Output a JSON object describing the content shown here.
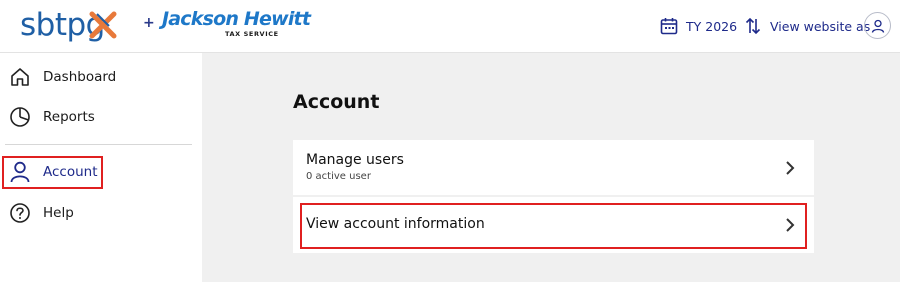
{
  "header": {
    "logo_text": "sbtpg",
    "partner_name": "Jackson Hewitt",
    "partner_sub": "TAX SERVICE",
    "tax_year": "TY 2026",
    "view_as_label": "View website as"
  },
  "sidebar": {
    "items": [
      {
        "label": "Dashboard",
        "icon": "home-icon"
      },
      {
        "label": "Reports",
        "icon": "pie-chart-icon"
      },
      {
        "label": "Account",
        "icon": "user-icon"
      },
      {
        "label": "Help",
        "icon": "help-icon"
      }
    ]
  },
  "main": {
    "title": "Account",
    "cards": [
      {
        "title": "Manage users",
        "subtitle": "0 active user"
      },
      {
        "title": "View account information"
      }
    ]
  },
  "colors": {
    "accent": "#1e2a8a",
    "highlight": "#e02020",
    "background": "#f0f0f0"
  }
}
